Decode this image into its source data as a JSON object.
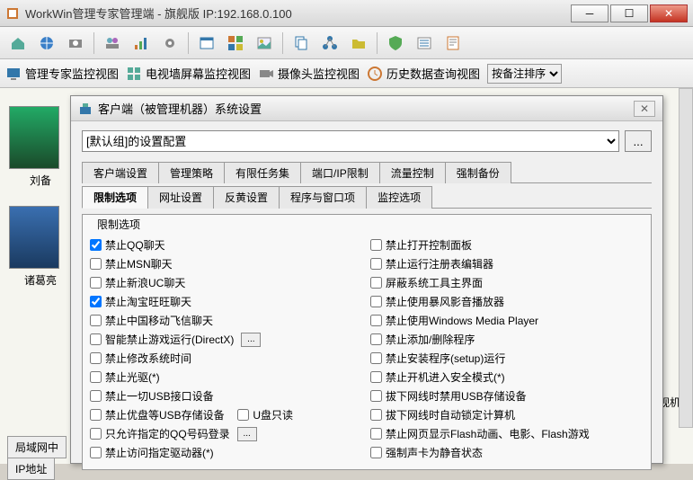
{
  "titlebar": {
    "title": "WorkWin管理专家管理端 - 旗舰版 IP:192.168.0.100"
  },
  "viewbar": {
    "v1": "管理专家监控视图",
    "v2": "电视墙屏幕监控视图",
    "v3": "摄像头监控视图",
    "v4": "历史数据查询视图",
    "sort_label": "按备注排序"
  },
  "thumbs": {
    "name1": "刘备",
    "name2": "诸葛亮"
  },
  "bottom_tabs": {
    "t1": "局域网中",
    "t2": "IP地址"
  },
  "right_text": "监视机器",
  "dialog": {
    "title": "客户端（被管理机器）系统设置",
    "combo_label": "[默认组]的设置配置",
    "ellipsis": "...",
    "tabs_row1": {
      "t1": "客户端设置",
      "t2": "管理策略",
      "t3": "有限任务集",
      "t4": "端口/IP限制",
      "t5": "流量控制",
      "t6": "强制备份"
    },
    "tabs_row2": {
      "t1": "限制选项",
      "t2": "网址设置",
      "t3": "反黄设置",
      "t4": "程序与窗口项",
      "t5": "监控选项"
    },
    "group_label": "限制选项",
    "left": {
      "c1": "禁止QQ聊天",
      "c2": "禁止MSN聊天",
      "c3": "禁止新浪UC聊天",
      "c4": "禁止淘宝旺旺聊天",
      "c5": "禁止中国移动飞信聊天",
      "c6": "智能禁止游戏运行(DirectX)",
      "c7": "禁止修改系统时间",
      "c8": "禁止光驱(*)",
      "c9": "禁止一切USB接口设备",
      "c10": "禁止优盘等USB存储设备",
      "c10b": "U盘只读",
      "c11": "只允许指定的QQ号码登录",
      "c12": "禁止访问指定驱动器(*)"
    },
    "right": {
      "c1": "禁止打开控制面板",
      "c2": "禁止运行注册表编辑器",
      "c3": "屏蔽系统工具主界面",
      "c4": "禁止使用暴风影音播放器",
      "c5": "禁止使用Windows Media Player",
      "c6": "禁止添加/删除程序",
      "c7": "禁止安装程序(setup)运行",
      "c8": "禁止开机进入安全模式(*)",
      "c9": "拔下网线时禁用USB存储设备",
      "c10": "拔下网线时自动锁定计算机",
      "c11": "禁止网页显示Flash动画、电影、Flash游戏",
      "c12": "强制声卡为静音状态"
    }
  }
}
